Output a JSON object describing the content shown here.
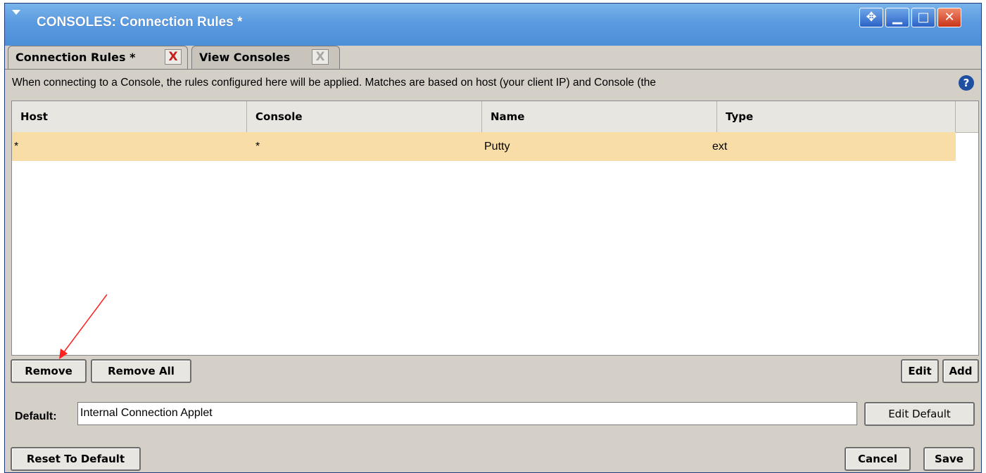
{
  "window": {
    "title": "CONSOLES: Connection Rules *",
    "buttons": {
      "move": "✥",
      "minimize": "▁",
      "maximize": "□",
      "close": "✕"
    }
  },
  "tabs": [
    {
      "label": "Connection Rules *",
      "close": "X",
      "active": true
    },
    {
      "label": "View Consoles",
      "close": "X",
      "active": false
    }
  ],
  "description": "When connecting to a Console, the rules configured here will be applied. Matches are based on host (your client IP) and Console (the",
  "help_icon": "?",
  "table": {
    "columns": [
      "Host",
      "Console",
      "Name",
      "Type"
    ],
    "rows": [
      {
        "host": "*",
        "console": "*",
        "name": "Putty",
        "type": "ext"
      }
    ],
    "selected_row_color": "#f8dea6"
  },
  "buttons": {
    "remove": "Remove",
    "remove_all": "Remove All",
    "edit": "Edit",
    "add": "Add",
    "edit_default": "Edit Default",
    "reset_to_default": "Reset To Default",
    "cancel": "Cancel",
    "save": "Save"
  },
  "default": {
    "label": "Default:",
    "value": "Internal Connection Applet"
  },
  "colors": {
    "titlebar": "#5a9be0",
    "panel": "#d4d0c8",
    "annotation_arrow": "#ff2020"
  }
}
